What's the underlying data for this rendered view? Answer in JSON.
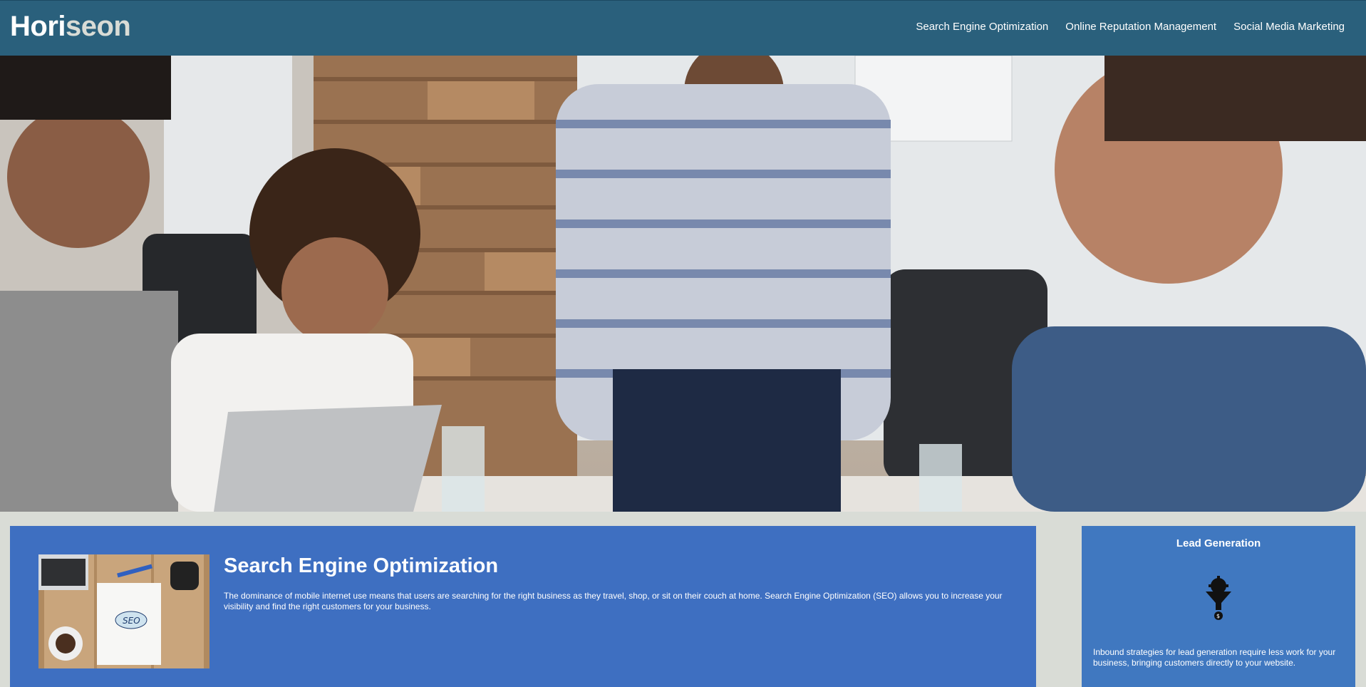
{
  "header": {
    "logo_main": "Hori",
    "logo_accent": "seon",
    "nav": [
      {
        "label": "Search Engine Optimization"
      },
      {
        "label": "Online Reputation Management"
      },
      {
        "label": "Social Media Marketing"
      }
    ]
  },
  "hero": {
    "image_icon": "team-meeting-photo"
  },
  "main": {
    "article": {
      "thumbnail_icon": "seo-notebook-photo",
      "title": "Search Engine Optimization",
      "text": "The dominance of mobile internet use means that users are searching for the right business as they travel, shop, or sit on their couch at home. Search Engine Optimization (SEO) allows you to increase your visibility and find the right customers for your business."
    },
    "aside": {
      "title": "Lead Generation",
      "icon": "lead-funnel-icon",
      "text": "Inbound strategies for lead generation require less work for your business, bringing customers directly to your website."
    }
  },
  "colors": {
    "header_bg": "#2a607c",
    "card_bg": "#3e6fc1",
    "side_bg": "#4078c0",
    "page_bg": "#d9dcd6"
  }
}
